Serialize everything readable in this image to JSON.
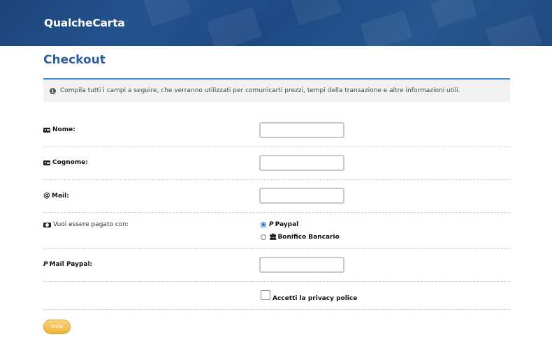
{
  "header": {
    "logo": "QualcheCarta"
  },
  "page": {
    "title": "Checkout",
    "info": "Compila tutti i campi a seguire, che verranno utilizzati per comunicarti prezzi, tempi della transazione e altre informazioni utili."
  },
  "form": {
    "nome_label": "Nome:",
    "cognome_label": "Cognome:",
    "mail_label": "Mail:",
    "payment_label": "Vuoi essere pagato con:",
    "payment_options": [
      {
        "label": "Paypal",
        "selected": true
      },
      {
        "label": "Bonifico Bancario",
        "selected": false
      }
    ],
    "paypal_label": "Mail Paypal:",
    "privacy_label": "Accetti la privacy police",
    "submit_label": "Invia"
  },
  "colors": {
    "header": "#1f4a82",
    "title": "#2b5f9e",
    "rule": "#3a8fd6",
    "button": "#f0b944"
  }
}
